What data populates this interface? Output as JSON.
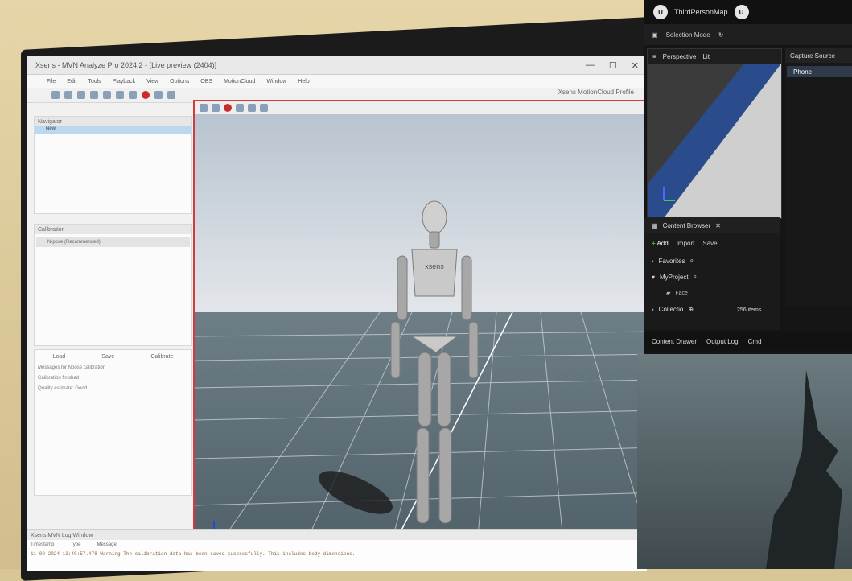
{
  "xsens": {
    "window_title": "Xsens - MVN Analyze Pro 2024.2 - [Live preview (2404)]",
    "profile": "Xsens MotionCloud Profile",
    "menu": [
      "File",
      "Edit",
      "Tools",
      "Playback",
      "View",
      "Options",
      "OBS",
      "MotionCloud",
      "Window",
      "Help"
    ],
    "navigator_title": "Navigator",
    "navigator_item": "New",
    "calibration_title": "Calibration",
    "calibration_item": "N-pose (Recommended)",
    "buttons": {
      "load": "Load",
      "save": "Save",
      "calibrate": "Calibrate"
    },
    "calibration_message_title": "Messages for Npose calibration",
    "calibration_messages": [
      "Calibration finished",
      "Quality estimate: Good"
    ],
    "log_window_title": "Xsens MVN Log Window",
    "log_columns": [
      "Timestamp",
      "Type",
      "Message"
    ],
    "log_line": "11-09-2024 13:40:57.478 Warning The calibration data has been saved successfully. This includes body dimensions.",
    "mannequin_chest_text": "xsens"
  },
  "unreal": {
    "map_name": "ThirdPersonMap",
    "selection_mode": "Selection Mode",
    "viewport_perspective": "Perspective",
    "viewport_lit": "Lit",
    "capture_source": "Capture Source",
    "capture_item": "Phone",
    "content_browser": "Content Browser",
    "add": "Add",
    "import": "Import",
    "save": "Save",
    "favorites": "Favorites",
    "my_project": "MyProject",
    "face_folder": "Face",
    "collections": "Collectio",
    "items_count": "256 items",
    "content_drawer": "Content Drawer",
    "output_log": "Output Log",
    "cmd": "Cmd"
  }
}
